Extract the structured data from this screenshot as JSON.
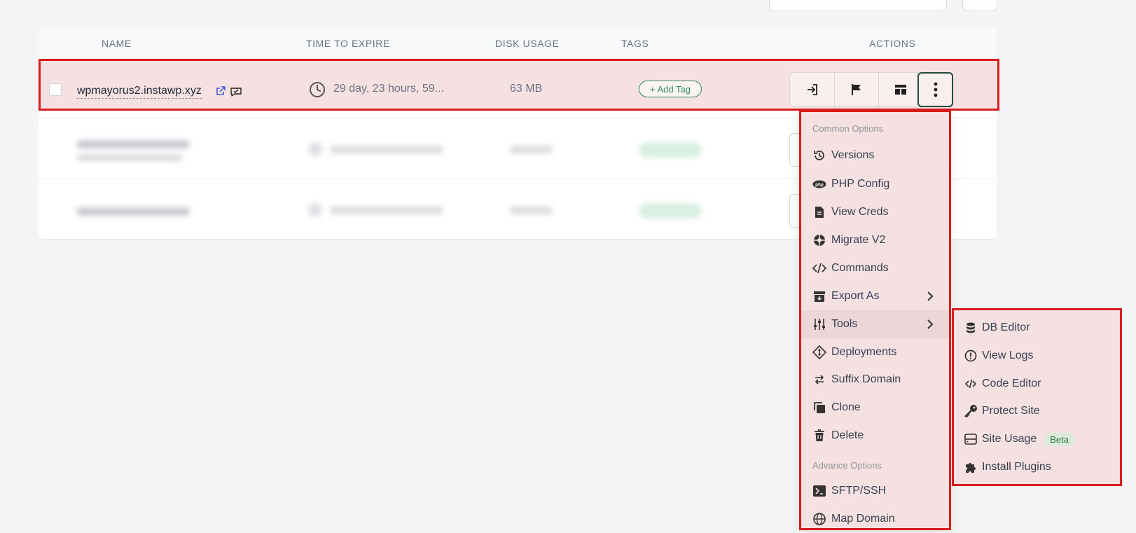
{
  "colors": {
    "highlight_border": "#d81b1b",
    "highlight_fill": "#f6e1e2",
    "tag_green": "#2f8a5b",
    "link_blue": "#3b5bdb"
  },
  "table": {
    "headers": {
      "name": "NAME",
      "time_to_expire": "TIME TO EXPIRE",
      "disk_usage": "DISK USAGE",
      "tags": "TAGS",
      "actions": "ACTIONS"
    },
    "rows": [
      {
        "site": "wpmayorus2.instawp.xyz",
        "expire": "29 day, 23 hours, 59...",
        "disk": "63 MB",
        "tag_button": "+ Add Tag"
      }
    ]
  },
  "action_icons": [
    "login-icon",
    "flag-icon",
    "layout-icon",
    "more-vertical-icon"
  ],
  "menu": {
    "common_heading": "Common Options",
    "items": [
      {
        "label": "Versions",
        "icon": "history-icon"
      },
      {
        "label": "PHP Config",
        "icon": "php-icon"
      },
      {
        "label": "View Creds",
        "icon": "document-icon"
      },
      {
        "label": "Migrate V2",
        "icon": "migrate-icon"
      },
      {
        "label": "Commands",
        "icon": "code-icon"
      },
      {
        "label": "Export As",
        "icon": "archive-icon"
      },
      {
        "label": "Tools",
        "icon": "sliders-icon"
      },
      {
        "label": "Deployments",
        "icon": "git-icon"
      },
      {
        "label": "Suffix Domain",
        "icon": "swap-icon"
      },
      {
        "label": "Clone",
        "icon": "copy-icon"
      },
      {
        "label": "Delete",
        "icon": "trash-icon"
      }
    ],
    "advance_heading": "Advance Options",
    "advance_items": [
      {
        "label": "SFTP/SSH",
        "icon": "terminal-icon"
      },
      {
        "label": "Map Domain",
        "icon": "globe-icon"
      }
    ]
  },
  "submenu": {
    "items": [
      {
        "label": "DB Editor",
        "icon": "database-icon"
      },
      {
        "label": "View Logs",
        "icon": "alert-circle-icon"
      },
      {
        "label": "Code Editor",
        "icon": "code-icon"
      },
      {
        "label": "Protect Site",
        "icon": "key-icon"
      },
      {
        "label": "Site Usage",
        "icon": "server-icon",
        "badge": "Beta"
      },
      {
        "label": "Install Plugins",
        "icon": "puzzle-icon"
      }
    ]
  }
}
